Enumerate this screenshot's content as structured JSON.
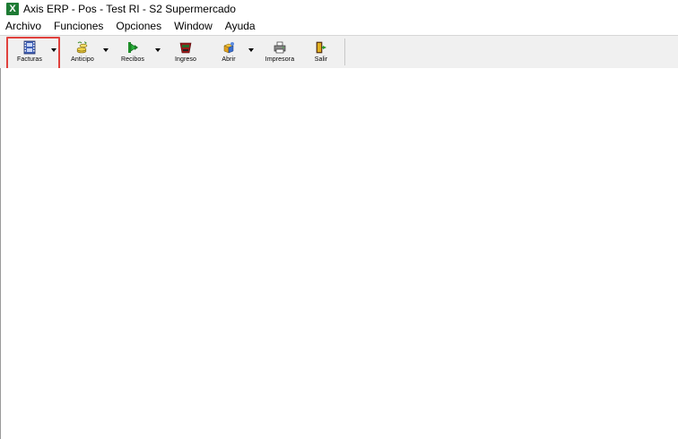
{
  "window": {
    "title": "Axis ERP - Pos - Test RI - S2 Supermercado",
    "app_icon_glyph": "X",
    "app_icon": "excel-x-icon",
    "app_icon_color": "#1e7b34"
  },
  "menu": {
    "items": [
      {
        "label": "Archivo"
      },
      {
        "label": "Funciones"
      },
      {
        "label": "Opciones"
      },
      {
        "label": "Window"
      },
      {
        "label": "Ayuda"
      }
    ]
  },
  "toolbar": {
    "buttons": [
      {
        "label": "Facturas",
        "icon": "film-icon",
        "has_dropdown": true,
        "highlighted": true
      },
      {
        "label": "Anticipo",
        "icon": "coins-icon",
        "has_dropdown": true
      },
      {
        "label": "Recibos",
        "icon": "green-arrow-icon",
        "has_dropdown": true
      },
      {
        "label": "Ingreso",
        "icon": "cash-register-icon",
        "has_dropdown": false
      },
      {
        "label": "Abrir",
        "icon": "open-box-icon",
        "has_dropdown": true
      },
      {
        "label": "Impresora",
        "icon": "printer-icon",
        "has_dropdown": false
      },
      {
        "label": "Salir",
        "icon": "exit-door-icon",
        "has_dropdown": false
      }
    ],
    "dropdown_arrow": "▾"
  },
  "highlight_color": "#e0413d"
}
